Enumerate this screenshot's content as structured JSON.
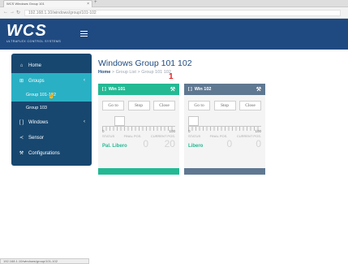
{
  "browser": {
    "tab_title": "WCS Windows Group 101",
    "url": "192.168.1.10/windows/group/101-102"
  },
  "header": {
    "logo_text": "WCS",
    "logo_subtitle": "ULTRAFLEX CONTROL SYSTEMS"
  },
  "sidebar": {
    "items": [
      {
        "label": "Home"
      },
      {
        "label": "Groups"
      },
      {
        "label": "Windows"
      },
      {
        "label": "Sensor"
      },
      {
        "label": "Configurations"
      }
    ],
    "sub_items": [
      {
        "label": "Group 101-102"
      },
      {
        "label": "Group 103"
      }
    ]
  },
  "main": {
    "title": "Windows Group 101 102",
    "breadcrumb": {
      "home": "Home",
      "sep": ">",
      "group_list": "Group List",
      "current": "Group 101 102"
    },
    "annotation": "1"
  },
  "cards": [
    {
      "title": "Win 101",
      "buttons": {
        "goto": "Go to",
        "stop": "Stop",
        "close": "Close"
      },
      "tick_min": "0",
      "tick_max": "100",
      "stat_labels": [
        "STATUS",
        "FINAL POS.",
        "CURRENT POS."
      ],
      "status": "Pal. Libero",
      "final_pos": "0",
      "current_pos": "20",
      "slider_level": 0.2
    },
    {
      "title": "Win 102",
      "buttons": {
        "goto": "Go to",
        "stop": "Stop",
        "close": "Close"
      },
      "tick_min": "0",
      "tick_max": "100",
      "stat_labels": [
        "STATUS",
        "FINAL POS.",
        "CURRENT POS."
      ],
      "status": "Libero",
      "final_pos": "0",
      "current_pos": "0",
      "slider_level": 0
    }
  ],
  "statusbar": {
    "text": "192.168.1.10/windows/group/101-102"
  },
  "colors": {
    "header": "#1f4a81",
    "sidebar": "#17476f",
    "active": "#2ab0c4",
    "card_green": "#23b993",
    "card_slate": "#5f7891"
  }
}
